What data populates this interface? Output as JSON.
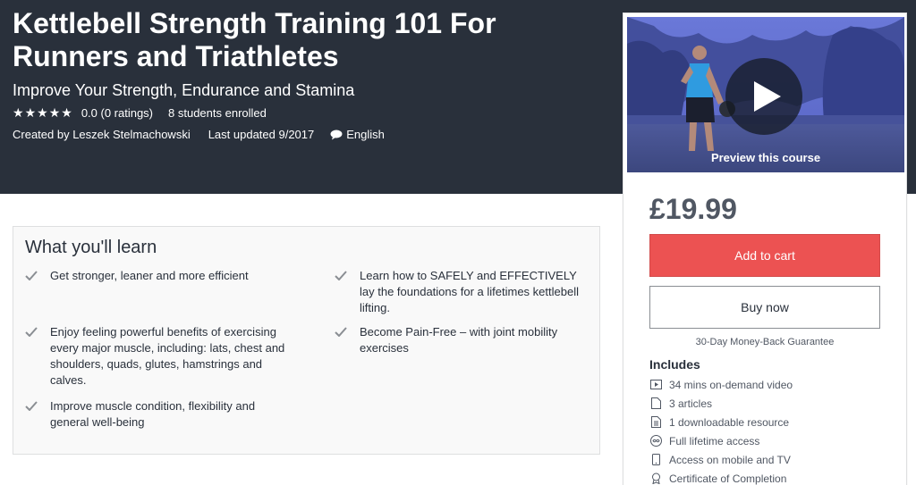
{
  "course": {
    "title": "Kettlebell Strength Training 101 For Runners and Triathletes",
    "subtitle": "Improve Your Strength, Endurance and Stamina",
    "rating_text": "0.0 (0 ratings)",
    "rating_value": 0.0,
    "stars_total": 5,
    "enrolled": "8 students enrolled",
    "created_by": "Created by Leszek Stelmachowski",
    "last_updated": "Last updated 9/2017",
    "language": "English"
  },
  "preview": {
    "caption": "Preview this course"
  },
  "purchase": {
    "price": "£19.99",
    "add_to_cart": "Add to cart",
    "buy_now": "Buy now",
    "guarantee": "30-Day Money-Back Guarantee",
    "includes_title": "Includes",
    "includes": [
      {
        "icon": "video-icon",
        "label": "34 mins on-demand video"
      },
      {
        "icon": "file-icon",
        "label": "3 articles"
      },
      {
        "icon": "document-icon",
        "label": "1 downloadable resource"
      },
      {
        "icon": "infinity-icon",
        "label": "Full lifetime access"
      },
      {
        "icon": "mobile-icon",
        "label": "Access on mobile and TV"
      },
      {
        "icon": "certificate-icon",
        "label": "Certificate of Completion"
      }
    ]
  },
  "learn": {
    "title": "What you'll learn",
    "items": [
      "Get stronger, leaner and more efficient",
      "Learn how to SAFELY and EFFECTIVELY lay the foundations for a lifetimes kettlebell lifting.",
      "Enjoy feeling powerful benefits of exercising every major muscle, including: lats, chest and shoulders, quads, glutes, hamstrings and calves.",
      "Become Pain-Free – with joint mobility exercises",
      "Improve muscle condition, flexibility and general well-being"
    ]
  },
  "colors": {
    "hero_bg": "#29303b",
    "accent_red": "#ec5252",
    "panel_bg": "#f9f9f9"
  }
}
